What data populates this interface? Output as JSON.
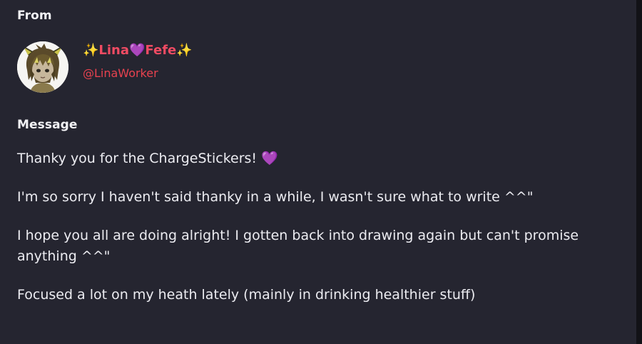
{
  "sections": {
    "from_label": "From",
    "message_label": "Message"
  },
  "sender": {
    "display_name": "✨Lina💜Fefe✨",
    "username": "@LinaWorker"
  },
  "message": {
    "paragraphs": [
      "Thanky you for the ChargeStickers! 💜",
      "I'm so sorry I haven't said thanky in a while, I wasn't sure what to write ^^\"",
      "I hope you all are doing alright! I gotten back into drawing again but can't promise anything ^^\"",
      "Focused a lot on my heath lately (mainly in drinking healthier stuff)"
    ]
  },
  "colors": {
    "background": "#252530",
    "name_accent": "#f04b63",
    "username_accent": "#e8424f",
    "scrollbar": "#121217"
  },
  "icons": {
    "avatar": "cartoon-character-avatar"
  }
}
